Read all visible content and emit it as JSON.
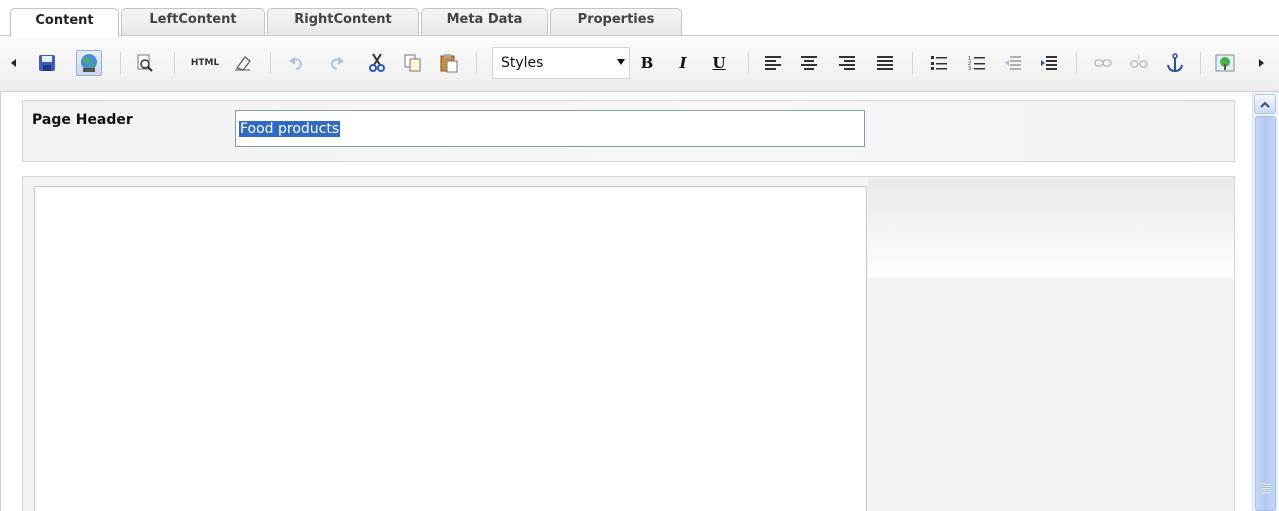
{
  "tabs": [
    {
      "label": "Content",
      "active": true
    },
    {
      "label": "LeftContent",
      "active": false
    },
    {
      "label": "RightContent",
      "active": false
    },
    {
      "label": "Meta Data",
      "active": false
    },
    {
      "label": "Properties",
      "active": false
    }
  ],
  "toolbar": {
    "styles_value": "Styles",
    "bold_label": "B",
    "italic_label": "I",
    "underline_label": "U",
    "html_label": "HTML",
    "icons": [
      "scroll-left-icon",
      "save-icon",
      "publish-globe-icon",
      "preview-icon",
      "html-source-icon",
      "eraser-icon",
      "undo-icon",
      "redo-icon",
      "cut-icon",
      "copy-icon",
      "paste-icon",
      "align-left-icon",
      "align-center-icon",
      "align-right-icon",
      "align-justify-icon",
      "bulleted-list-icon",
      "numbered-list-icon",
      "outdent-icon",
      "indent-icon",
      "link-icon",
      "unlink-icon",
      "anchor-icon",
      "insert-image-icon",
      "scroll-right-icon"
    ]
  },
  "form": {
    "page_header_label": "Page Header",
    "page_header_value": "Food products"
  },
  "colors": {
    "selection": "#316ac5",
    "input_border": "#7f9db9",
    "scrollbar": "#c6d6f6"
  }
}
